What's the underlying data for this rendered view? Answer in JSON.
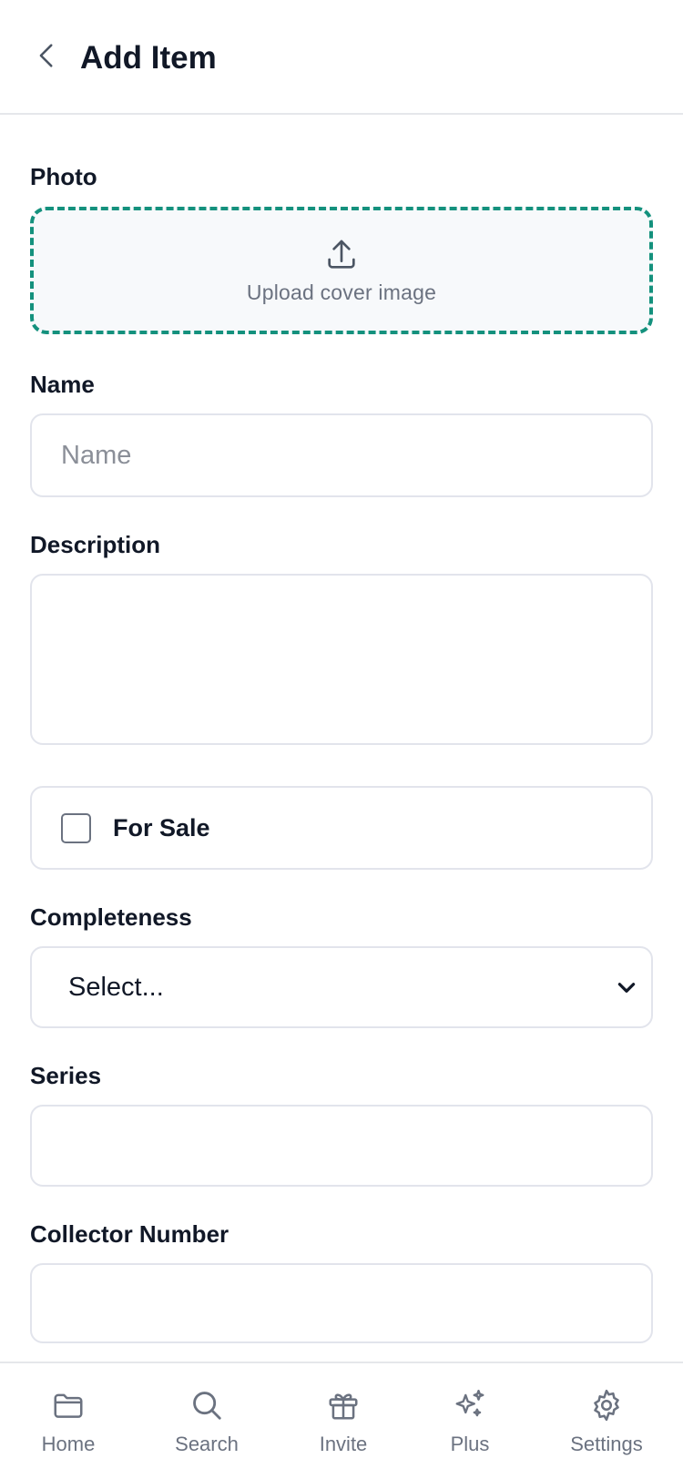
{
  "header": {
    "title": "Add Item",
    "back_icon": "chevron-left-icon"
  },
  "form": {
    "photo": {
      "label": "Photo",
      "upload_text": "Upload cover image",
      "icon": "upload-icon"
    },
    "name": {
      "label": "Name",
      "placeholder": "Name",
      "value": ""
    },
    "description": {
      "label": "Description",
      "value": ""
    },
    "for_sale": {
      "label": "For Sale",
      "checked": false
    },
    "completeness": {
      "label": "Completeness",
      "selected": "Select..."
    },
    "series": {
      "label": "Series",
      "value": ""
    },
    "collector_number": {
      "label": "Collector Number",
      "value": ""
    }
  },
  "bottom_nav": {
    "items": [
      {
        "label": "Home",
        "icon": "folder-icon"
      },
      {
        "label": "Search",
        "icon": "search-icon"
      },
      {
        "label": "Invite",
        "icon": "gift-icon"
      },
      {
        "label": "Plus",
        "icon": "sparkles-icon"
      },
      {
        "label": "Settings",
        "icon": "gear-icon"
      }
    ]
  },
  "colors": {
    "accent": "#14917d",
    "text": "#111827",
    "muted": "#6b7280",
    "border": "#e2e4ec"
  }
}
